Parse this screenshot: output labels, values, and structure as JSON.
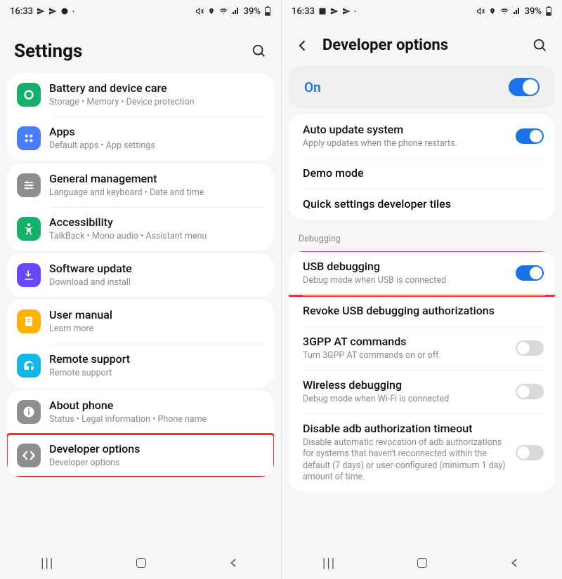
{
  "left": {
    "status": {
      "time": "16:33",
      "battery": "39%"
    },
    "title": "Settings",
    "groups": [
      {
        "items": [
          {
            "icon": "battery",
            "label": "Battery and device care",
            "sub": "Storage  •  Memory  •  Device protection",
            "color": "#17b06a"
          },
          {
            "icon": "apps",
            "label": "Apps",
            "sub": "Default apps  •  App settings",
            "color": "#4a7cff"
          }
        ]
      },
      {
        "items": [
          {
            "icon": "sliders",
            "label": "General management",
            "sub": "Language and keyboard  •  Date and time",
            "color": "#8e8e8e"
          },
          {
            "icon": "a11y",
            "label": "Accessibility",
            "sub": "TalkBack  •  Mono audio  •  Assistant menu",
            "color": "#17b06a"
          }
        ]
      },
      {
        "items": [
          {
            "icon": "update",
            "label": "Software update",
            "sub": "Download and install",
            "color": "#6a45ff"
          }
        ]
      },
      {
        "items": [
          {
            "icon": "manual",
            "label": "User manual",
            "sub": "Learn more",
            "color": "#ffb300"
          },
          {
            "icon": "support",
            "label": "Remote support",
            "sub": "Remote support",
            "color": "#12b7e5"
          }
        ]
      },
      {
        "items": [
          {
            "icon": "info",
            "label": "About phone",
            "sub": "Status  •  Legal information  •  Phone name",
            "color": "#8e8e8e"
          },
          {
            "icon": "dev",
            "label": "Developer options",
            "sub": "Developer options",
            "color": "#8e8e8e",
            "highlight": true
          }
        ]
      }
    ]
  },
  "right": {
    "status": {
      "time": "16:33",
      "battery": "39%"
    },
    "title": "Developer options",
    "master": {
      "label": "On",
      "on": true
    },
    "groups": [
      {
        "items": [
          {
            "label": "Auto update system",
            "sub": "Apply updates when the phone restarts.",
            "toggle": true,
            "on": true
          },
          {
            "label": "Demo mode"
          },
          {
            "label": "Quick settings developer tiles"
          }
        ]
      },
      {
        "title": "Debugging",
        "items": [
          {
            "label": "USB debugging",
            "sub": "Debug mode when USB is connected",
            "toggle": true,
            "on": true,
            "highlight": true
          },
          {
            "label": "Revoke USB debugging authorizations"
          },
          {
            "label": "3GPP AT commands",
            "sub": "Turn 3GPP AT commands on or off.",
            "toggle": true,
            "on": false
          },
          {
            "label": "Wireless debugging",
            "sub": "Debug mode when Wi-Fi is connected",
            "toggle": true,
            "on": false
          },
          {
            "label": "Disable adb authorization timeout",
            "sub": "Disable automatic revocation of adb authorizations for systems that haven't reconnected within the default (7 days) or user-configured (minimum 1 day) amount of time.",
            "toggle": true,
            "on": false
          }
        ]
      }
    ]
  }
}
